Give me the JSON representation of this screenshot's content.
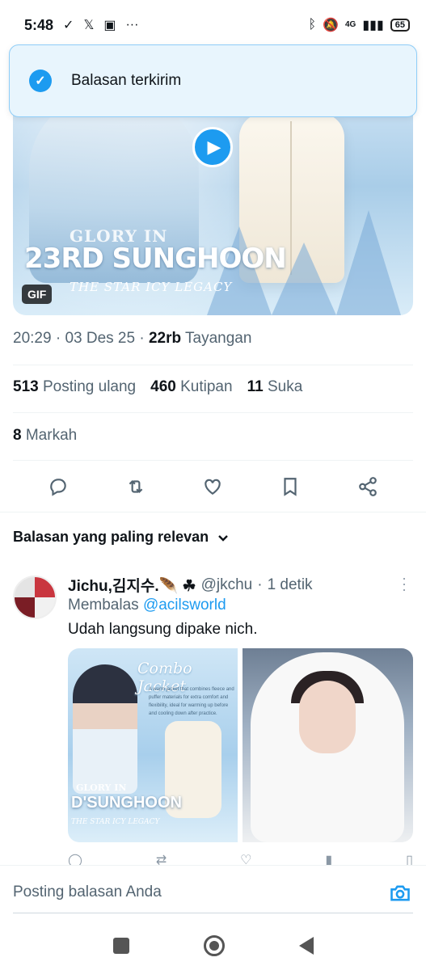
{
  "status_bar": {
    "time": "5:48",
    "left_icons": [
      "check-icon",
      "x-logo-icon",
      "app-icon",
      "more-icon"
    ],
    "more": "···",
    "network": "4G",
    "battery": "65"
  },
  "toast": {
    "text": "Balasan terkirim"
  },
  "media": {
    "title_line1": "GLORY IN",
    "title_line2": "23RD SUNGHOON",
    "title_line3": "THE STAR ICY LEGACY",
    "badge": "GIF"
  },
  "tweet_meta": {
    "time": "20:29",
    "date": "03 Des 25",
    "views_count": "22rb",
    "views_label": "Tayangan"
  },
  "stats": {
    "reposts_count": "513",
    "reposts_label": "Posting ulang",
    "quotes_count": "460",
    "quotes_label": "Kutipan",
    "likes_count": "11",
    "likes_label": "Suka",
    "bookmarks_count": "8",
    "bookmarks_label": "Markah"
  },
  "actions": [
    "reply-icon",
    "retweet-icon",
    "like-icon",
    "bookmark-icon",
    "share-icon"
  ],
  "replies_sort": {
    "label": "Balasan yang paling relevan"
  },
  "reply": {
    "name": "Jichu,김지수.🪶 ☘",
    "handle": "@jkchu",
    "time": "1 detik",
    "replying_prefix": "Membalas",
    "replying_to": "@acilsworld",
    "text": "Udah langsung dipake nich.",
    "image1": {
      "title_line1": "Combo Jacket",
      "desc": "A warm jacket that combines fleece and puffer materials for extra comfort and flexibility, ideal for warming up before and cooling down after practice.",
      "title_line2": "GLORY IN",
      "title_line3": "D'SUNGHOON",
      "title_line4": "THE STAR ICY LEGACY"
    }
  },
  "compose": {
    "placeholder": "Posting balasan Anda"
  }
}
